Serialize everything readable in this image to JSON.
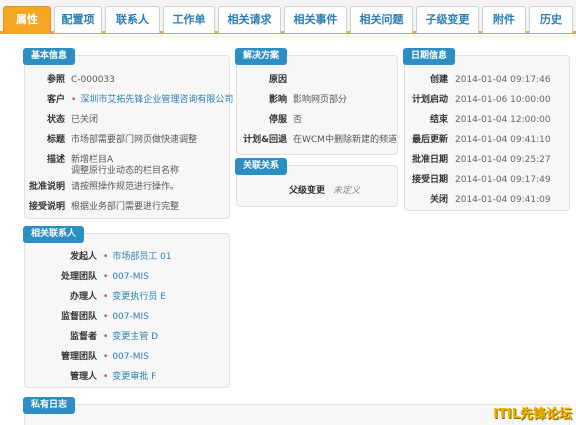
{
  "tabs": [
    {
      "label": "属性",
      "active": true
    },
    {
      "label": "配置项"
    },
    {
      "label": "联系人"
    },
    {
      "label": "工作单"
    },
    {
      "label": "相关请求"
    },
    {
      "label": "相关事件"
    },
    {
      "label": "相关问题"
    },
    {
      "label": "子级变更"
    },
    {
      "label": "附件"
    },
    {
      "label": "历史"
    }
  ],
  "basic": {
    "title": "基本信息",
    "ref_label": "参照",
    "ref_value": "C-000033",
    "customer_label": "客户",
    "customer_value": "深圳市艾拓先锋企业管理咨询有限公司",
    "status_label": "状态",
    "status_value": "已关闭",
    "subject_label": "标题",
    "subject_value": "市场部需要部门网页做快速调整",
    "desc_label": "描述",
    "desc_line1": "新增栏目A",
    "desc_line2": "调整原行业动态的栏目名称",
    "approval_label": "批准说明",
    "approval_value": "请按照操作规范进行操作。",
    "accept_label": "接受说明",
    "accept_value": "根据业务部门需要进行完整"
  },
  "solution": {
    "title": "解决方案",
    "cause_label": "原因",
    "cause_value": "",
    "impact_label": "影响",
    "impact_value": "影响网页部分",
    "outage_label": "停服",
    "outage_value": "否",
    "plan_label": "计划&回退",
    "plan_value": "在WCM中删除新建的频道"
  },
  "relation": {
    "title": "关联关系",
    "parent_label": "父级变更",
    "parent_value": "未定义"
  },
  "dates": {
    "title": "日期信息",
    "created_label": "创建",
    "created_value": "2014-01-04 09:17:46",
    "planstart_label": "计划启动",
    "planstart_value": "2014-01-06 10:00:00",
    "end_label": "结束",
    "end_value": "2014-01-04 12:00:00",
    "updated_label": "最后更新",
    "updated_value": "2014-01-04 09:41:10",
    "approved_label": "批准日期",
    "approved_value": "2014-01-04 09:25:27",
    "accepted_label": "接受日期",
    "accepted_value": "2014-01-04 09:17:49",
    "closed_label": "关闭",
    "closed_value": "2014-01-04 09:41:09"
  },
  "contacts": {
    "title": "相关联系人",
    "initiator_label": "发起人",
    "initiator_value": "市场部员工 01",
    "handle_team_label": "处理团队",
    "handle_team_value": "007-MIS",
    "handler_label": "办理人",
    "handler_value": "变更执行员 E",
    "sup_team_label": "监督团队",
    "sup_team_value": "007-MIS",
    "supervisor_label": "监督者",
    "supervisor_value": "变更主管 D",
    "mgmt_team_label": "管理团队",
    "mgmt_team_value": "007-MIS",
    "manager_label": "管理人",
    "manager_value": "变更审批 F"
  },
  "private_log": {
    "title": "私有日志"
  },
  "watermark": "ITIL先锋论坛"
}
